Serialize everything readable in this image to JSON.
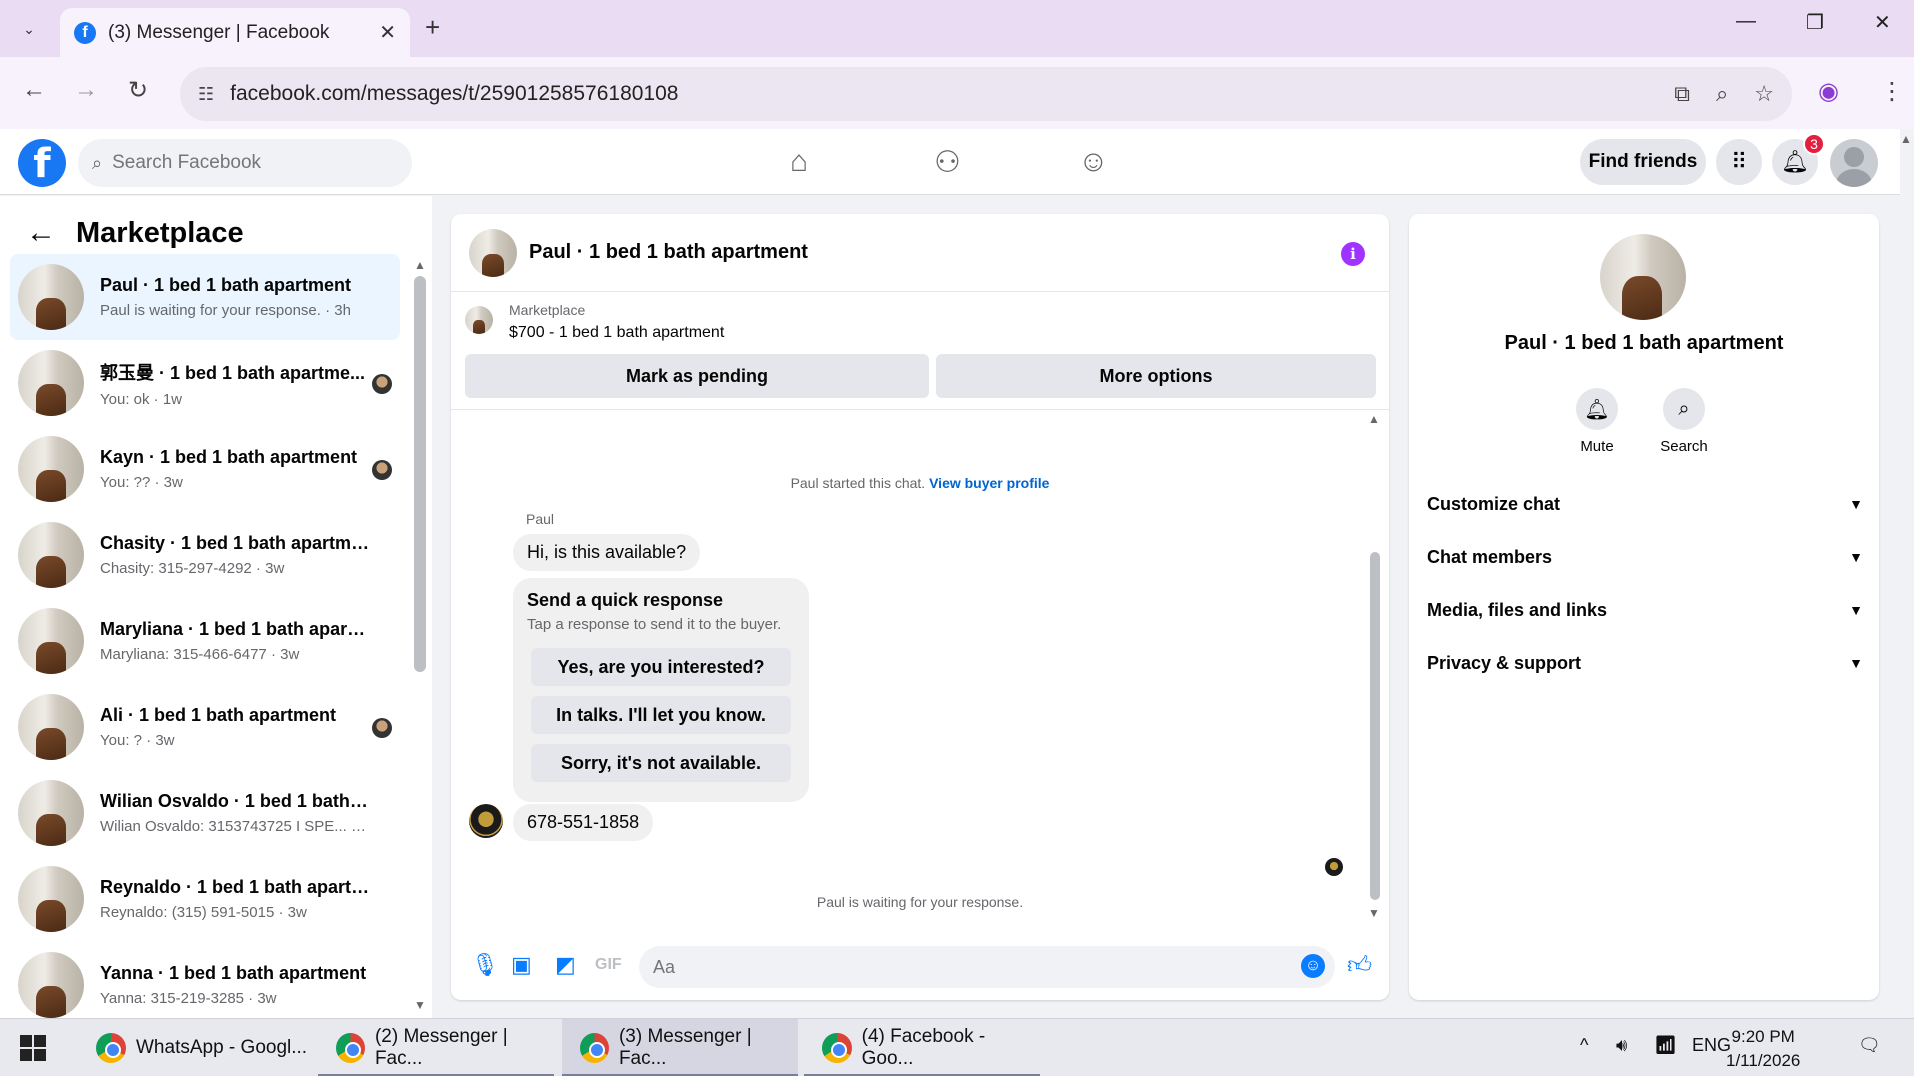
{
  "browser": {
    "tab_title": "(3) Messenger | Facebook",
    "url": "facebook.com/messages/t/25901258576180108"
  },
  "header": {
    "search_placeholder": "Search Facebook",
    "find_friends": "Find friends",
    "notification_count": "3"
  },
  "sidebar": {
    "title": "Marketplace",
    "conversations": [
      {
        "name": "Paul · 1 bed 1 bath apartment",
        "sub": "Paul is waiting for your response. · 3h",
        "active": true
      },
      {
        "name": "郭玉曼 · 1 bed 1 bath apartme...",
        "sub": "You: ok · 1w"
      },
      {
        "name": "Kayn · 1 bed 1 bath apartment",
        "sub": "You: ?? · 3w"
      },
      {
        "name": "Chasity · 1 bed 1 bath apartment",
        "sub": "Chasity: 315-297-4292 · 3w"
      },
      {
        "name": "Maryliana · 1 bed 1 bath apartm...",
        "sub": "Maryliana: 315-466-6477 · 3w"
      },
      {
        "name": "Ali · 1 bed 1 bath apartment",
        "sub": "You: ? · 3w"
      },
      {
        "name": "Wilian Osvaldo · 1 bed 1 bath ap...",
        "sub": "Wilian Osvaldo: 3153743725 I SPE... · 3w"
      },
      {
        "name": "Reynaldo · 1 bed 1 bath apartm...",
        "sub": "Reynaldo: (315) 591-5015 · 3w"
      },
      {
        "name": "Yanna · 1 bed 1 bath apartment",
        "sub": "Yanna: 315-219-3285 · 3w"
      }
    ]
  },
  "chat": {
    "title": "Paul · 1 bed 1 bath apartment",
    "listing_label": "Marketplace",
    "listing_price": "$700 - 1 bed 1 bath apartment",
    "mark_pending": "Mark as pending",
    "more_options": "More options",
    "started_text": "Paul started this chat.",
    "view_profile": "View buyer profile",
    "sender": "Paul",
    "msg1": "Hi, is this available?",
    "quick_title": "Send a quick response",
    "quick_sub": "Tap a response to send it to the buyer.",
    "quick_replies": [
      "Yes, are you interested?",
      "In talks. I'll let you know.",
      "Sorry, it's not available."
    ],
    "msg2": "678-551-1858",
    "waiting": "Paul is waiting for your response.",
    "composer_placeholder": "Aa"
  },
  "info_panel": {
    "name": "Paul · 1 bed 1 bath apartment",
    "mute": "Mute",
    "search": "Search",
    "sections": [
      "Customize chat",
      "Chat members",
      "Media, files and links",
      "Privacy & support"
    ]
  },
  "taskbar": {
    "items": [
      "WhatsApp - Googl...",
      "(2) Messenger | Fac...",
      "(3) Messenger | Fac...",
      "(4) Facebook - Goo..."
    ],
    "language": "ENG",
    "time": "9:20 PM",
    "date": "1/11/2026"
  }
}
